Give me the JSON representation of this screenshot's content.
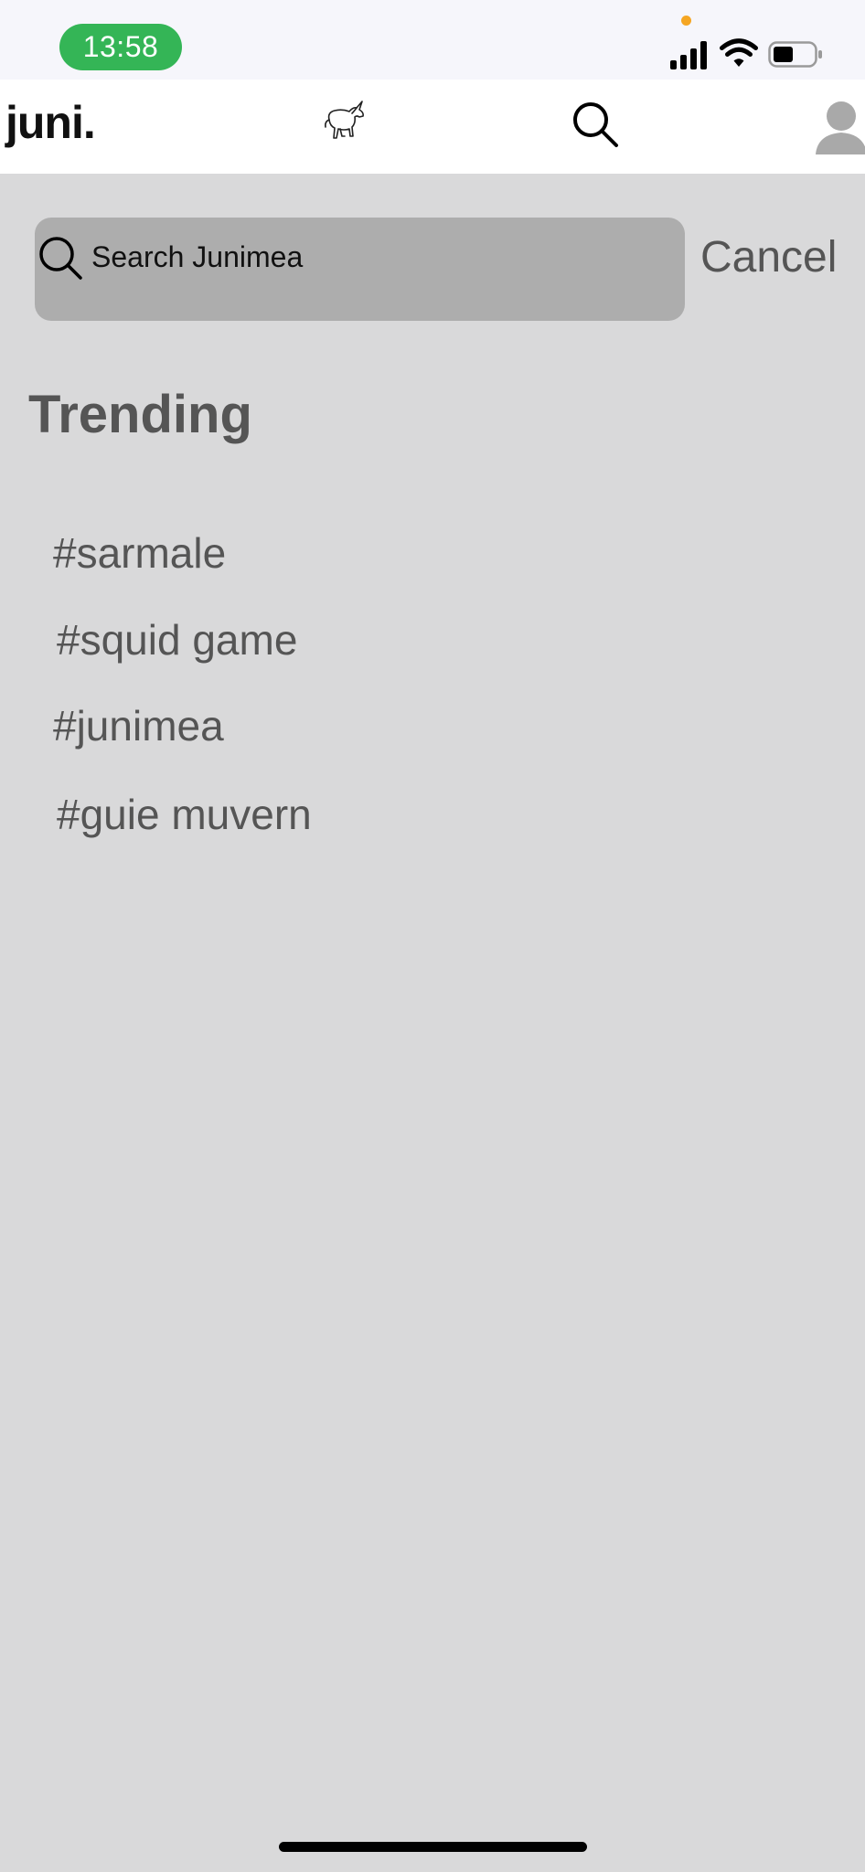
{
  "status_bar": {
    "time": "13:58",
    "time_pill_color": "#34b556",
    "signal_icon": "cellular-signal-icon",
    "wifi_icon": "wifi-icon",
    "battery_icon": "battery-icon",
    "battery_level": 0.5
  },
  "header": {
    "brand": "juni.",
    "logo_icon": "unicorn-icon",
    "search_icon": "search-icon",
    "profile_icon": "avatar"
  },
  "search": {
    "placeholder": "Search Junimea",
    "value": "",
    "cancel_label": "Cancel"
  },
  "trending": {
    "title": "Trending",
    "items": [
      {
        "label": "#sarmale"
      },
      {
        "label": "#squid game"
      },
      {
        "label": "#junimea"
      },
      {
        "label": "#guie muvern"
      }
    ]
  }
}
